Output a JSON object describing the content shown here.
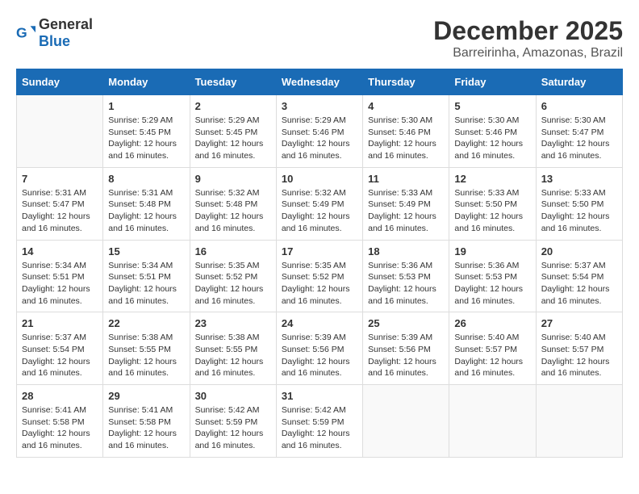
{
  "logo": {
    "general": "General",
    "blue": "Blue"
  },
  "header": {
    "month": "December 2025",
    "location": "Barreirinha, Amazonas, Brazil"
  },
  "weekdays": [
    "Sunday",
    "Monday",
    "Tuesday",
    "Wednesday",
    "Thursday",
    "Friday",
    "Saturday"
  ],
  "weeks": [
    [
      {
        "day": "",
        "info": ""
      },
      {
        "day": "1",
        "info": "Sunrise: 5:29 AM\nSunset: 5:45 PM\nDaylight: 12 hours and 16 minutes."
      },
      {
        "day": "2",
        "info": "Sunrise: 5:29 AM\nSunset: 5:45 PM\nDaylight: 12 hours and 16 minutes."
      },
      {
        "day": "3",
        "info": "Sunrise: 5:29 AM\nSunset: 5:46 PM\nDaylight: 12 hours and 16 minutes."
      },
      {
        "day": "4",
        "info": "Sunrise: 5:30 AM\nSunset: 5:46 PM\nDaylight: 12 hours and 16 minutes."
      },
      {
        "day": "5",
        "info": "Sunrise: 5:30 AM\nSunset: 5:46 PM\nDaylight: 12 hours and 16 minutes."
      },
      {
        "day": "6",
        "info": "Sunrise: 5:30 AM\nSunset: 5:47 PM\nDaylight: 12 hours and 16 minutes."
      }
    ],
    [
      {
        "day": "7",
        "info": "Sunrise: 5:31 AM\nSunset: 5:47 PM\nDaylight: 12 hours and 16 minutes."
      },
      {
        "day": "8",
        "info": "Sunrise: 5:31 AM\nSunset: 5:48 PM\nDaylight: 12 hours and 16 minutes."
      },
      {
        "day": "9",
        "info": "Sunrise: 5:32 AM\nSunset: 5:48 PM\nDaylight: 12 hours and 16 minutes."
      },
      {
        "day": "10",
        "info": "Sunrise: 5:32 AM\nSunset: 5:49 PM\nDaylight: 12 hours and 16 minutes."
      },
      {
        "day": "11",
        "info": "Sunrise: 5:33 AM\nSunset: 5:49 PM\nDaylight: 12 hours and 16 minutes."
      },
      {
        "day": "12",
        "info": "Sunrise: 5:33 AM\nSunset: 5:50 PM\nDaylight: 12 hours and 16 minutes."
      },
      {
        "day": "13",
        "info": "Sunrise: 5:33 AM\nSunset: 5:50 PM\nDaylight: 12 hours and 16 minutes."
      }
    ],
    [
      {
        "day": "14",
        "info": "Sunrise: 5:34 AM\nSunset: 5:51 PM\nDaylight: 12 hours and 16 minutes."
      },
      {
        "day": "15",
        "info": "Sunrise: 5:34 AM\nSunset: 5:51 PM\nDaylight: 12 hours and 16 minutes."
      },
      {
        "day": "16",
        "info": "Sunrise: 5:35 AM\nSunset: 5:52 PM\nDaylight: 12 hours and 16 minutes."
      },
      {
        "day": "17",
        "info": "Sunrise: 5:35 AM\nSunset: 5:52 PM\nDaylight: 12 hours and 16 minutes."
      },
      {
        "day": "18",
        "info": "Sunrise: 5:36 AM\nSunset: 5:53 PM\nDaylight: 12 hours and 16 minutes."
      },
      {
        "day": "19",
        "info": "Sunrise: 5:36 AM\nSunset: 5:53 PM\nDaylight: 12 hours and 16 minutes."
      },
      {
        "day": "20",
        "info": "Sunrise: 5:37 AM\nSunset: 5:54 PM\nDaylight: 12 hours and 16 minutes."
      }
    ],
    [
      {
        "day": "21",
        "info": "Sunrise: 5:37 AM\nSunset: 5:54 PM\nDaylight: 12 hours and 16 minutes."
      },
      {
        "day": "22",
        "info": "Sunrise: 5:38 AM\nSunset: 5:55 PM\nDaylight: 12 hours and 16 minutes."
      },
      {
        "day": "23",
        "info": "Sunrise: 5:38 AM\nSunset: 5:55 PM\nDaylight: 12 hours and 16 minutes."
      },
      {
        "day": "24",
        "info": "Sunrise: 5:39 AM\nSunset: 5:56 PM\nDaylight: 12 hours and 16 minutes."
      },
      {
        "day": "25",
        "info": "Sunrise: 5:39 AM\nSunset: 5:56 PM\nDaylight: 12 hours and 16 minutes."
      },
      {
        "day": "26",
        "info": "Sunrise: 5:40 AM\nSunset: 5:57 PM\nDaylight: 12 hours and 16 minutes."
      },
      {
        "day": "27",
        "info": "Sunrise: 5:40 AM\nSunset: 5:57 PM\nDaylight: 12 hours and 16 minutes."
      }
    ],
    [
      {
        "day": "28",
        "info": "Sunrise: 5:41 AM\nSunset: 5:58 PM\nDaylight: 12 hours and 16 minutes."
      },
      {
        "day": "29",
        "info": "Sunrise: 5:41 AM\nSunset: 5:58 PM\nDaylight: 12 hours and 16 minutes."
      },
      {
        "day": "30",
        "info": "Sunrise: 5:42 AM\nSunset: 5:59 PM\nDaylight: 12 hours and 16 minutes."
      },
      {
        "day": "31",
        "info": "Sunrise: 5:42 AM\nSunset: 5:59 PM\nDaylight: 12 hours and 16 minutes."
      },
      {
        "day": "",
        "info": ""
      },
      {
        "day": "",
        "info": ""
      },
      {
        "day": "",
        "info": ""
      }
    ]
  ]
}
